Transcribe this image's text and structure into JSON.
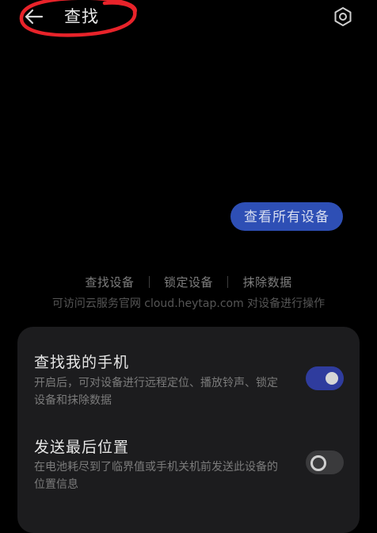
{
  "header": {
    "title": "查找",
    "back_icon": "arrow-left-icon",
    "settings_icon": "hexagon-settings-icon"
  },
  "main": {
    "view_all_button": "查看所有设备",
    "actions": [
      "查找设备",
      "锁定设备",
      "抹除数据"
    ],
    "hint": "可访问云服务官网 cloud.heytap.com 对设备进行操作"
  },
  "settings": [
    {
      "title": "查找我的手机",
      "description": "开启后，可对设备进行远程定位、播放铃声、锁定设备和抹除数据",
      "enabled": true
    },
    {
      "title": "发送最后位置",
      "description": "在电池耗尽到了临界值或手机关机前发送此设备的位置信息",
      "enabled": false
    }
  ],
  "colors": {
    "accent": "#2e4fb5",
    "toggle_on": "#2f3c9e",
    "card_bg": "#1c1c1e",
    "annotation_red": "#e8232a"
  }
}
